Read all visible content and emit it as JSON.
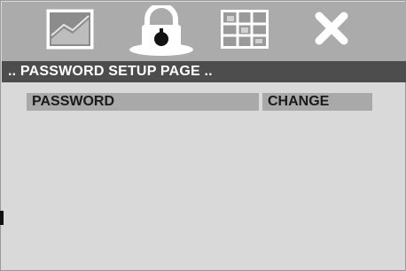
{
  "toolbar": {
    "icons": [
      "picture-icon",
      "lock-icon",
      "grid-icon",
      "close-icon"
    ]
  },
  "header": {
    "title": ".. PASSWORD SETUP PAGE .."
  },
  "rows": [
    {
      "label": "PASSWORD",
      "value": "CHANGE"
    }
  ],
  "colors": {
    "background": "#d9d9d9",
    "toolbar": "#ababab",
    "header_bar": "#4d4d4d",
    "row_highlight": "#a9a9a9"
  }
}
